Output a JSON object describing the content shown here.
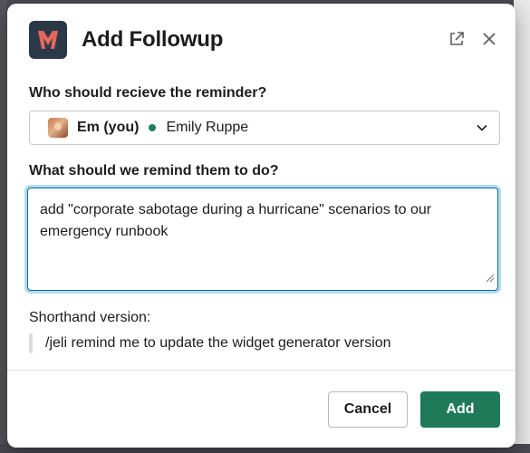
{
  "modal": {
    "title": "Add Followup"
  },
  "form": {
    "recipient_label": "Who should recieve the reminder?",
    "recipient": {
      "you_label": "Em (you)",
      "name": "Emily Ruppe",
      "presence_color": "#1d7f5e"
    },
    "task_label": "What should we remind them to do?",
    "task_value": "add \"corporate sabotage during a hurricane\" scenarios to our emergency runbook",
    "shorthand_label": "Shorthand version:",
    "shorthand_value": "/jeli remind me to update the widget generator version"
  },
  "footer": {
    "cancel_label": "Cancel",
    "add_label": "Add",
    "add_color": "#1f7a5a"
  },
  "icons": {
    "logo": "app-logo-icon",
    "popout": "external-link-icon",
    "close": "close-icon",
    "dropdown": "chevron-down-icon",
    "resize": "resize-grip-icon"
  }
}
